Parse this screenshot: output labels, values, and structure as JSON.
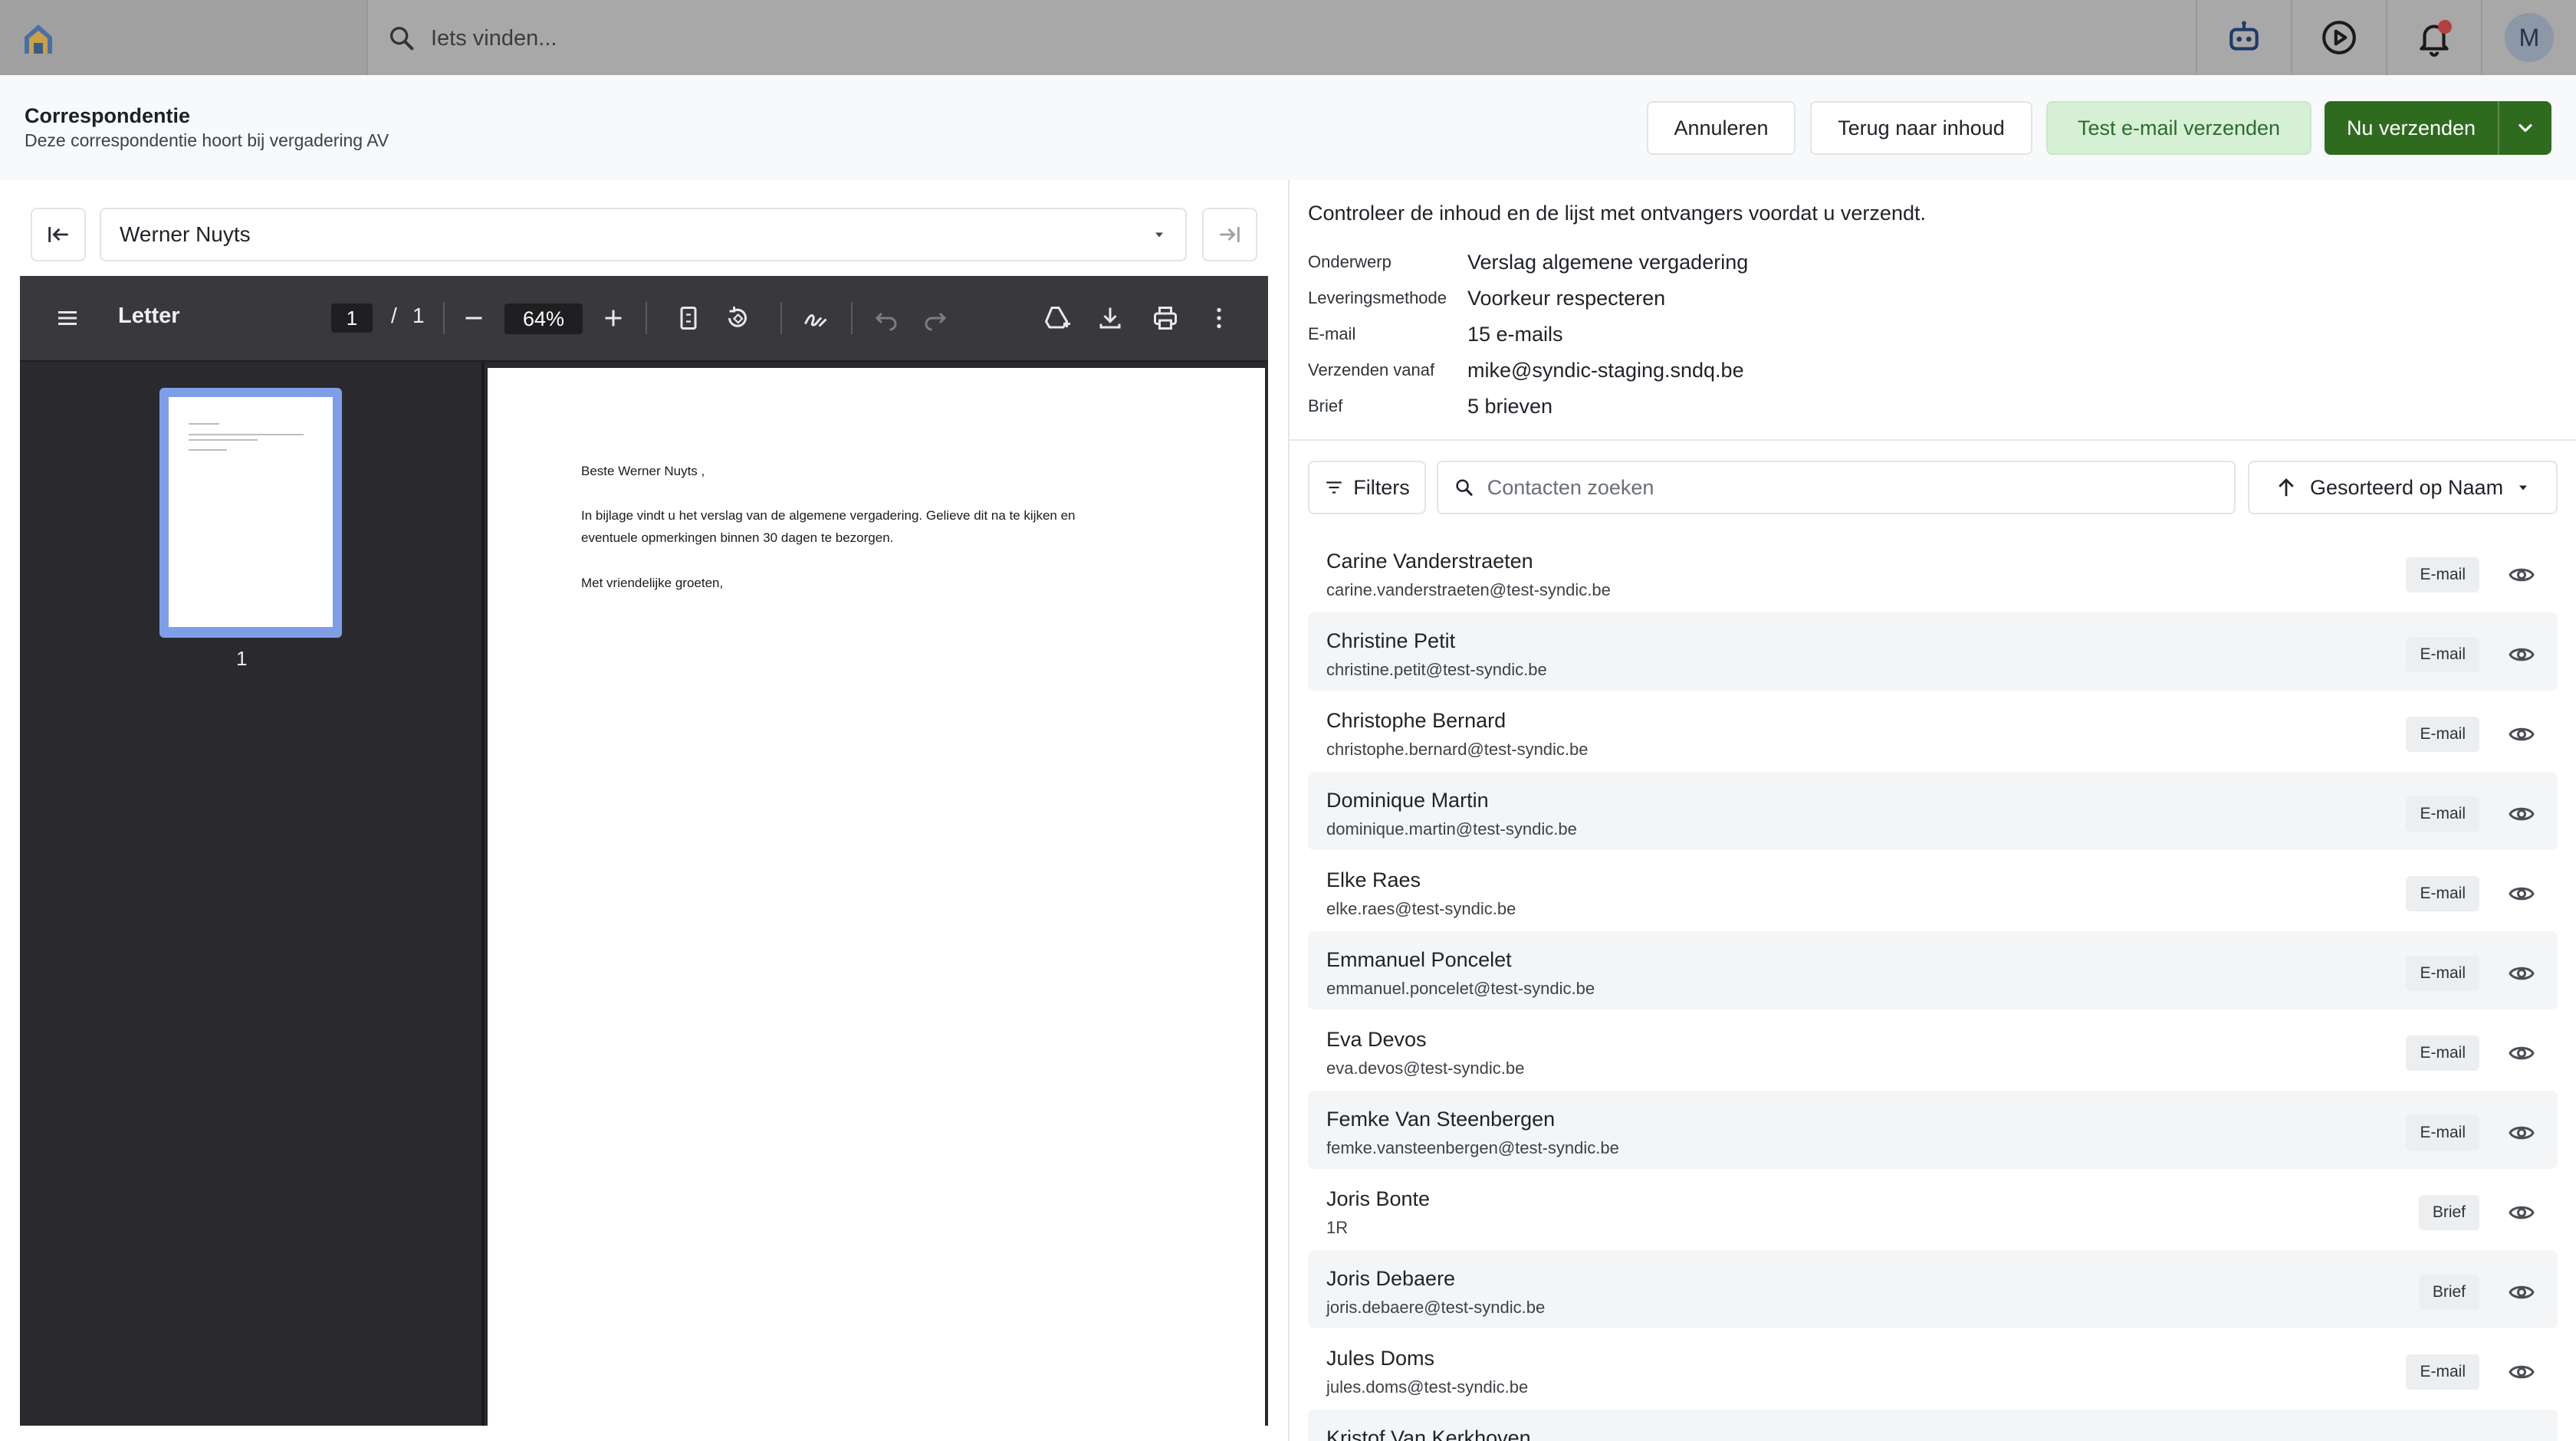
{
  "topbar": {
    "search_placeholder": "Iets vinden...",
    "avatar_initial": "M"
  },
  "header": {
    "title": "Correspondentie",
    "subtitle": "Deze correspondentie hoort bij vergadering AV",
    "cancel_label": "Annuleren",
    "back_label": "Terug naar inhoud",
    "test_label": "Test e-mail verzenden",
    "send_label": "Nu verzenden"
  },
  "preview": {
    "recipient": "Werner Nuyts",
    "viewer": {
      "title": "Letter",
      "page_current": "1",
      "page_sep": "/",
      "page_total": "1",
      "zoom": "64%",
      "thumb_number": "1"
    },
    "letter": {
      "greeting": "Beste Werner Nuyts ,",
      "body_line1": "In bijlage vindt u het verslag van de algemene vergadering. Gelieve dit na te kijken en",
      "body_line2": "eventuele opmerkingen binnen 30 dagen te bezorgen.",
      "closing": "Met vriendelijke groeten,"
    }
  },
  "summary": {
    "intro": "Controleer de inhoud en de lijst met ontvangers voordat u verzendt.",
    "rows": [
      {
        "label": "Onderwerp",
        "value": "Verslag algemene vergadering"
      },
      {
        "label": "Leveringsmethode",
        "value": "Voorkeur respecteren"
      },
      {
        "label": "E-mail",
        "value": "15 e-mails"
      },
      {
        "label": "Verzenden vanaf",
        "value": "mike@syndic-staging.sndq.be"
      },
      {
        "label": "Brief",
        "value": "5 brieven"
      }
    ]
  },
  "controls": {
    "filters_label": "Filters",
    "search_placeholder": "Contacten zoeken",
    "sort_label": "Gesorteerd op Naam"
  },
  "contacts": [
    {
      "name": "Carine Vanderstraeten",
      "sub": "carine.vanderstraeten@test-syndic.be",
      "method": "E-mail"
    },
    {
      "name": "Christine Petit",
      "sub": "christine.petit@test-syndic.be",
      "method": "E-mail"
    },
    {
      "name": "Christophe Bernard",
      "sub": "christophe.bernard@test-syndic.be",
      "method": "E-mail"
    },
    {
      "name": "Dominique Martin",
      "sub": "dominique.martin@test-syndic.be",
      "method": "E-mail"
    },
    {
      "name": "Elke Raes",
      "sub": "elke.raes@test-syndic.be",
      "method": "E-mail"
    },
    {
      "name": "Emmanuel Poncelet",
      "sub": "emmanuel.poncelet@test-syndic.be",
      "method": "E-mail"
    },
    {
      "name": "Eva Devos",
      "sub": "eva.devos@test-syndic.be",
      "method": "E-mail"
    },
    {
      "name": "Femke Van Steenbergen",
      "sub": "femke.vansteenbergen@test-syndic.be",
      "method": "E-mail"
    },
    {
      "name": "Joris Bonte",
      "sub": "1R",
      "method": "Brief"
    },
    {
      "name": "Joris Debaere",
      "sub": "joris.debaere@test-syndic.be",
      "method": "Brief"
    },
    {
      "name": "Jules Doms",
      "sub": "jules.doms@test-syndic.be",
      "method": "E-mail"
    },
    {
      "name": "Kristof Van Kerkhoven",
      "sub": "",
      "method": ""
    }
  ],
  "colors": {
    "primary": "#2f6b1f",
    "test_bg": "#d6f0d6",
    "test_text": "#2d6b2d",
    "viewer_dark": "#2a2a2e",
    "thumb_highlight": "#7e9fe8"
  }
}
